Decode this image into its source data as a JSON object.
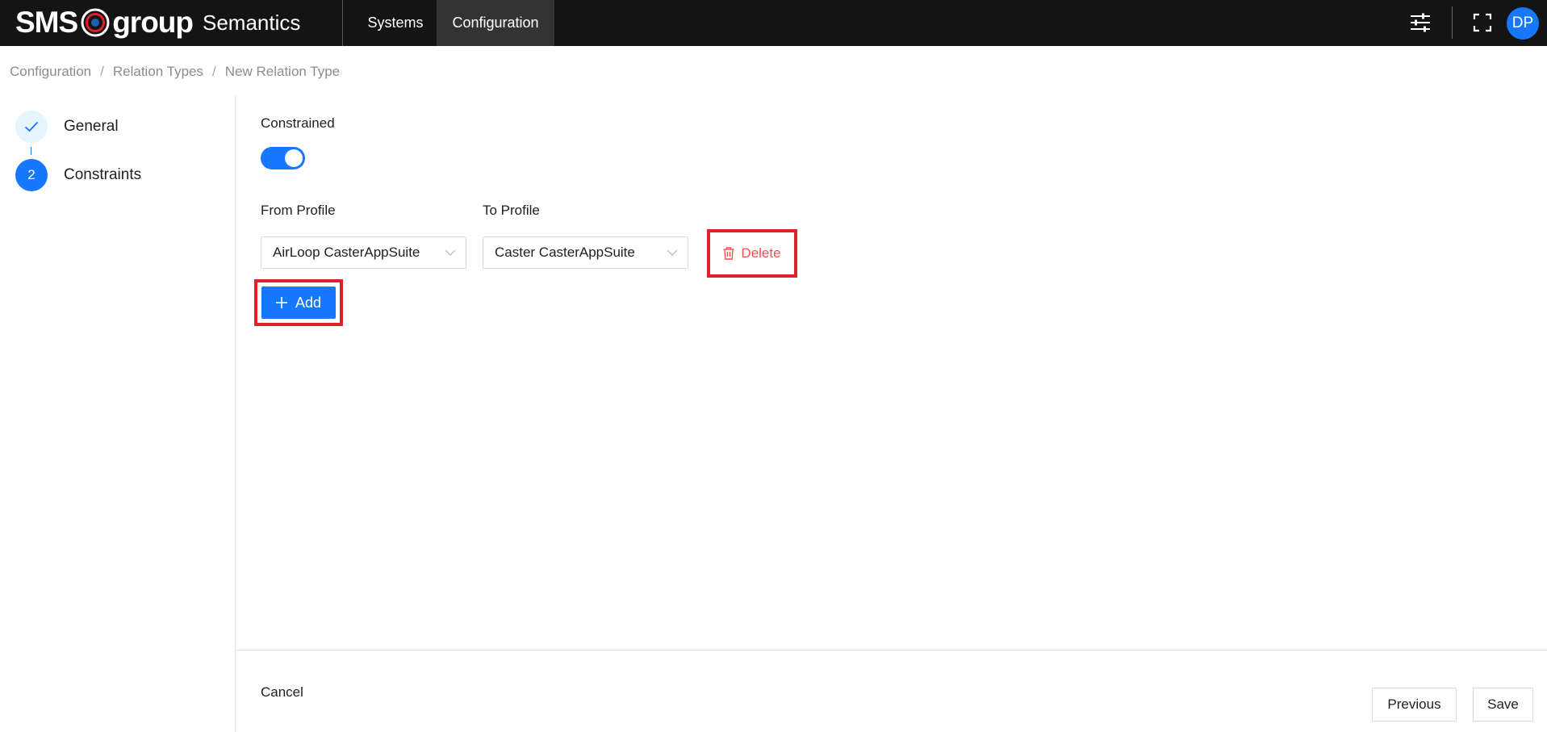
{
  "app": {
    "brand_left": "SMS",
    "brand_right": "group",
    "product": "Semantics"
  },
  "nav": {
    "items": [
      {
        "label": "Systems",
        "active": false
      },
      {
        "label": "Configuration",
        "active": true
      }
    ]
  },
  "header_icons": [
    "sliders-icon",
    "fullscreen-icon"
  ],
  "user": {
    "initials": "DP"
  },
  "breadcrumb": {
    "items": [
      "Configuration",
      "Relation Types",
      "New Relation Type"
    ],
    "separator": "/"
  },
  "steps": [
    {
      "number": "",
      "label": "General",
      "status": "done"
    },
    {
      "number": "2",
      "label": "Constraints",
      "status": "active"
    }
  ],
  "form": {
    "constrained_label": "Constrained",
    "constrained_on": true,
    "from_profile_label": "From Profile",
    "to_profile_label": "To Profile",
    "rows": [
      {
        "from": "AirLoop CasterAppSuite",
        "to": "Caster CasterAppSuite",
        "delete_label": "Delete"
      }
    ],
    "add_label": "Add"
  },
  "footer": {
    "cancel_label": "Cancel",
    "previous_label": "Previous",
    "save_label": "Save"
  },
  "colors": {
    "primary": "#1677ff",
    "danger": "#ff4d4f",
    "highlight": "#e0202a",
    "topbar": "#141414"
  }
}
